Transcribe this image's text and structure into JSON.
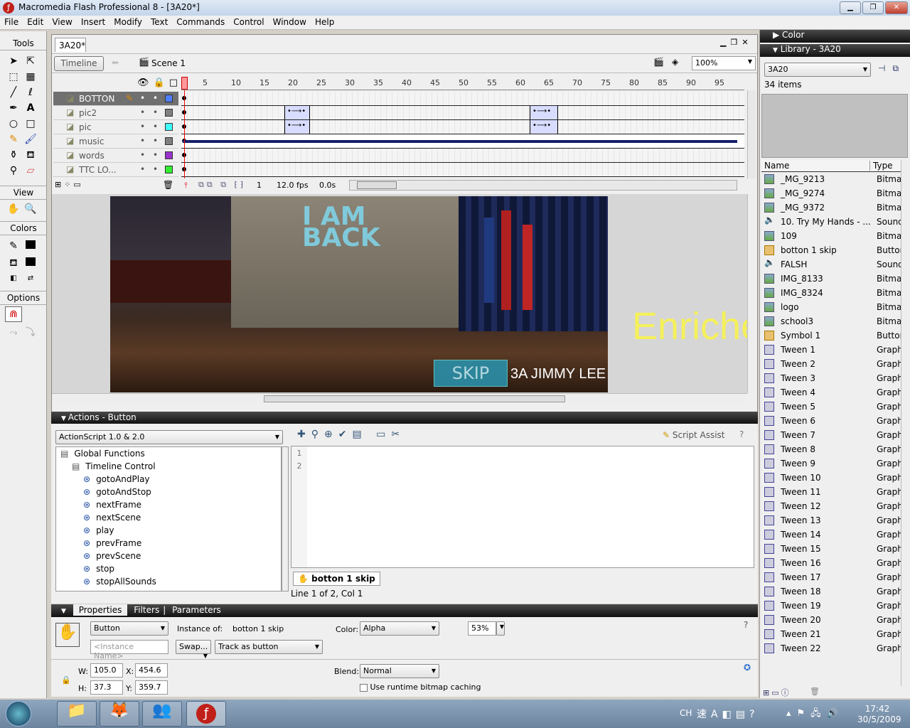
{
  "window": {
    "title": "Macromedia Flash Professional 8 - [3A20*]",
    "min": "▁",
    "max": "❐",
    "close": "✕"
  },
  "menu": [
    "File",
    "Edit",
    "View",
    "Insert",
    "Modify",
    "Text",
    "Commands",
    "Control",
    "Window",
    "Help"
  ],
  "tools": {
    "title": "Tools",
    "view": "View",
    "colors": "Colors",
    "options": "Options"
  },
  "document": {
    "tab": "3A20*",
    "timeline_button": "Timeline",
    "scene": "Scene 1",
    "zoom": "100%"
  },
  "timeline": {
    "ruler": [
      "1",
      "5",
      "10",
      "15",
      "20",
      "25",
      "30",
      "35",
      "40",
      "45",
      "50",
      "55",
      "60",
      "65",
      "70",
      "75",
      "80",
      "85",
      "90",
      "95"
    ],
    "layers": [
      {
        "name": "BOTTON",
        "color": "#4f7fff",
        "selected": true
      },
      {
        "name": "pic2",
        "color": "#808080"
      },
      {
        "name": "pic",
        "color": "#40ffff"
      },
      {
        "name": "music",
        "color": "#808080"
      },
      {
        "name": "words",
        "color": "#9933cc"
      },
      {
        "name": "TTC LO...",
        "color": "#33ee33"
      }
    ],
    "current_frame": "1",
    "fps": "12.0 fps",
    "time": "0.0s"
  },
  "stage": {
    "screen_text": "I AM BACK",
    "side_text": "Enriche",
    "skip_label": "SKIP",
    "credit": "3A JIMMY LEE",
    "text_color": "#f5f05a",
    "button_color": "#2a8fa8"
  },
  "actions": {
    "title": "Actions - Button",
    "version": "ActionScript 1.0 & 2.0",
    "script_assist": "Script Assist",
    "tree": [
      {
        "label": "Global Functions",
        "level": 0
      },
      {
        "label": "Timeline Control",
        "level": 1
      },
      {
        "label": "gotoAndPlay",
        "level": 2
      },
      {
        "label": "gotoAndStop",
        "level": 2
      },
      {
        "label": "nextFrame",
        "level": 2
      },
      {
        "label": "nextScene",
        "level": 2
      },
      {
        "label": "play",
        "level": 2
      },
      {
        "label": "prevFrame",
        "level": 2
      },
      {
        "label": "prevScene",
        "level": 2
      },
      {
        "label": "stop",
        "level": 2
      },
      {
        "label": "stopAllSounds",
        "level": 2
      }
    ],
    "line_numbers": [
      "1",
      "2"
    ],
    "script_tab": "botton 1 skip",
    "status": "Line 1 of 2, Col 1"
  },
  "properties": {
    "tabs": [
      "Properties",
      "Filters",
      "Parameters"
    ],
    "symbol_type": "Button",
    "instance_name_placeholder": "<Instance Name>",
    "instance_of_label": "Instance of:",
    "instance_of": "botton 1 skip",
    "swap": "Swap...",
    "track": "Track as button",
    "color_label": "Color:",
    "color": "Alpha",
    "alpha": "53%",
    "w_label": "W:",
    "w": "105.0",
    "h_label": "H:",
    "h": "37.3",
    "x_label": "X:",
    "x": "454.6",
    "y_label": "Y:",
    "y": "359.7",
    "blend_label": "Blend:",
    "blend": "Normal",
    "cache_label": "Use runtime bitmap caching"
  },
  "color_panel": {
    "title": "Color"
  },
  "library": {
    "title": "Library - 3A20",
    "doc": "3A20",
    "count": "34 items",
    "col_name": "Name",
    "col_type": "Type",
    "items": [
      {
        "name": "_MG_9213",
        "type": "Bitmap",
        "icon": "bitmap"
      },
      {
        "name": "_MG_9274",
        "type": "Bitmap",
        "icon": "bitmap"
      },
      {
        "name": "_MG_9372",
        "type": "Bitmap",
        "icon": "bitmap"
      },
      {
        "name": "10. Try My Hands - ...",
        "type": "Sound",
        "icon": "sound"
      },
      {
        "name": "109",
        "type": "Bitmap",
        "icon": "bitmap"
      },
      {
        "name": "botton 1 skip",
        "type": "Button",
        "icon": "button"
      },
      {
        "name": "FALSH",
        "type": "Sound",
        "icon": "sound"
      },
      {
        "name": "IMG_8133",
        "type": "Bitmap",
        "icon": "bitmap"
      },
      {
        "name": "IMG_8324",
        "type": "Bitmap",
        "icon": "bitmap"
      },
      {
        "name": "logo",
        "type": "Bitmap",
        "icon": "bitmap"
      },
      {
        "name": "school3",
        "type": "Bitmap",
        "icon": "bitmap"
      },
      {
        "name": "Symbol 1",
        "type": "Button",
        "icon": "button"
      },
      {
        "name": "Tween 1",
        "type": "Graphic",
        "icon": "graphic"
      },
      {
        "name": "Tween 2",
        "type": "Graphic",
        "icon": "graphic"
      },
      {
        "name": "Tween 3",
        "type": "Graphic",
        "icon": "graphic"
      },
      {
        "name": "Tween 4",
        "type": "Graphic",
        "icon": "graphic"
      },
      {
        "name": "Tween 5",
        "type": "Graphic",
        "icon": "graphic"
      },
      {
        "name": "Tween 6",
        "type": "Graphic",
        "icon": "graphic"
      },
      {
        "name": "Tween 7",
        "type": "Graphic",
        "icon": "graphic"
      },
      {
        "name": "Tween 8",
        "type": "Graphic",
        "icon": "graphic"
      },
      {
        "name": "Tween 9",
        "type": "Graphic",
        "icon": "graphic"
      },
      {
        "name": "Tween 10",
        "type": "Graphic",
        "icon": "graphic"
      },
      {
        "name": "Tween 11",
        "type": "Graphic",
        "icon": "graphic"
      },
      {
        "name": "Tween 12",
        "type": "Graphic",
        "icon": "graphic"
      },
      {
        "name": "Tween 13",
        "type": "Graphic",
        "icon": "graphic"
      },
      {
        "name": "Tween 14",
        "type": "Graphic",
        "icon": "graphic"
      },
      {
        "name": "Tween 15",
        "type": "Graphic",
        "icon": "graphic"
      },
      {
        "name": "Tween 16",
        "type": "Graphic",
        "icon": "graphic"
      },
      {
        "name": "Tween 17",
        "type": "Graphic",
        "icon": "graphic"
      },
      {
        "name": "Tween 18",
        "type": "Graphic",
        "icon": "graphic"
      },
      {
        "name": "Tween 19",
        "type": "Graphic",
        "icon": "graphic"
      },
      {
        "name": "Tween 20",
        "type": "Graphic",
        "icon": "graphic"
      },
      {
        "name": "Tween 21",
        "type": "Graphic",
        "icon": "graphic"
      },
      {
        "name": "Tween 22",
        "type": "Graphic",
        "icon": "graphic"
      }
    ]
  },
  "taskbar": {
    "lang": "CH",
    "time": "17:42",
    "date": "30/5/2009"
  }
}
